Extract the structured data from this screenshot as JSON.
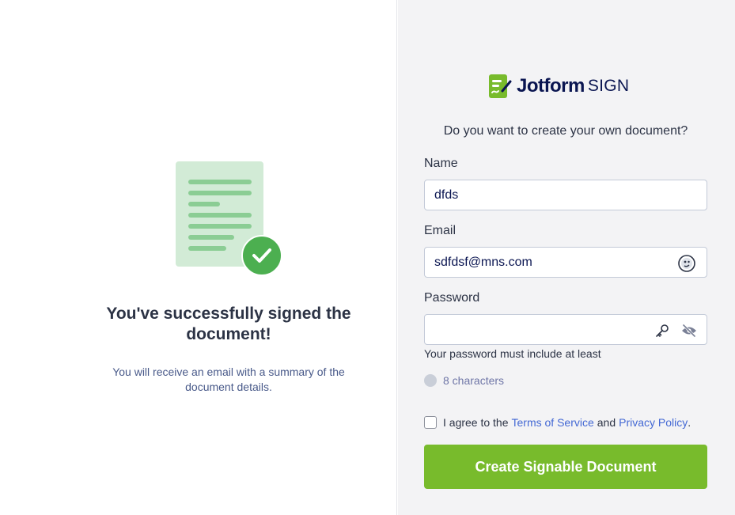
{
  "success": {
    "title": "You've successfully signed the document!",
    "subtitle": "You will receive an email with a summary of the document details."
  },
  "brand": {
    "name": "Jotform",
    "product": "SIGN",
    "colors": {
      "green": "#78bb2c",
      "navy": "#0a1551",
      "link": "#4368d4"
    }
  },
  "signup": {
    "question": "Do you want to create your own document?",
    "name_label": "Name",
    "name_value": "dfds",
    "email_label": "Email",
    "email_value": "sdfdsf@mns.com",
    "password_label": "Password",
    "password_value": "",
    "password_hint": "Your password must include at least",
    "password_rule": "8 characters",
    "agree_prefix": "I agree to the",
    "terms_link": "Terms of Service",
    "agree_and": "and",
    "privacy_link": "Privacy Policy",
    "agree_suffix": ".",
    "submit_label": "Create Signable Document"
  },
  "icons": {
    "email_field": "duckduckgo-icon",
    "password_key": "key-icon",
    "password_toggle": "eye-slash-icon",
    "success": "check-circle-icon"
  }
}
